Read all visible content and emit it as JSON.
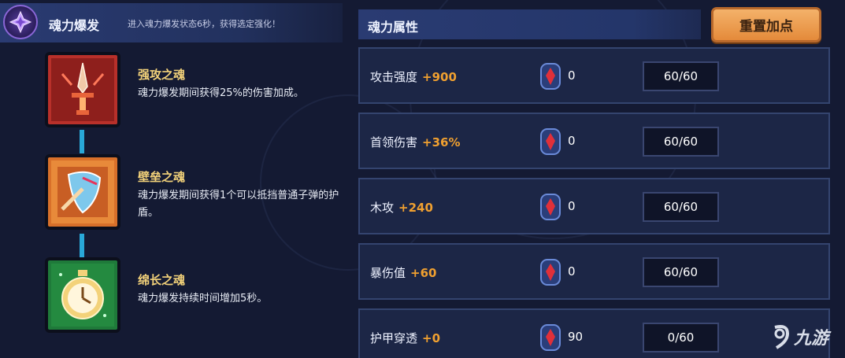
{
  "burst": {
    "title": "魂力爆发",
    "description": "进入魂力爆发状态6秒，获得选定强化！",
    "icon": "purple-crystal-icon"
  },
  "skills": [
    {
      "name": "强攻之魂",
      "description": "魂力爆发期间获得25%的伤害加成。",
      "icon": "sword-icon",
      "color": "#c93a2e"
    },
    {
      "name": "壁垒之魂",
      "description": "魂力爆发期间获得1个可以抵挡普通子弹的护盾。",
      "icon": "shield-icon",
      "color": "#e07a28"
    },
    {
      "name": "绵长之魂",
      "description": "魂力爆发持续时间增加5秒。",
      "icon": "stopwatch-icon",
      "color": "#2e9a4a"
    }
  ],
  "attributes": {
    "title": "魂力属性",
    "reset_label": "重置加点",
    "rows": [
      {
        "name": "攻击强度",
        "bonus": "+900",
        "gem_count": "0",
        "points": "60/60"
      },
      {
        "name": "首领伤害",
        "bonus": "+36%",
        "gem_count": "0",
        "points": "60/60"
      },
      {
        "name": "木攻",
        "bonus": "+240",
        "gem_count": "0",
        "points": "60/60"
      },
      {
        "name": "暴伤值",
        "bonus": "+60",
        "gem_count": "0",
        "points": "60/60"
      },
      {
        "name": "护甲穿透",
        "bonus": "+0",
        "gem_count": "90",
        "points": "0/60"
      }
    ]
  },
  "watermark": {
    "text": "九游",
    "icon": "nine-game-logo-icon"
  },
  "colors": {
    "accent_orange": "#f0a030",
    "connector_blue": "#29a8d8",
    "reset_button": "#e48a3a"
  }
}
